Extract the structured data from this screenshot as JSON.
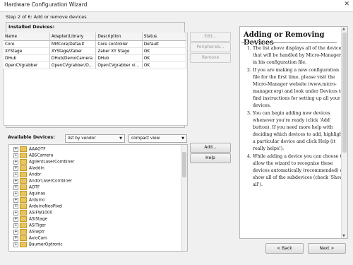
{
  "window": {
    "title": "Hardware Configuration Wizard",
    "close_glyph": "✕"
  },
  "step_label": "Step 2 of 6: Add or remove devices",
  "installed": {
    "label": "Installed Devices:",
    "columns": [
      "Name",
      "Adapter/Library",
      "Description",
      "Status"
    ],
    "rows": [
      [
        "Core",
        "MMCore/Default",
        "Core controller",
        "Default"
      ],
      [
        "XYStage",
        "XYStage/Zaber",
        "Zaber XY Stage",
        "OK"
      ],
      [
        "DHub",
        "DHub/DemoCamera",
        "DHub",
        "OK"
      ],
      [
        "OpenCVgrabber",
        "OpenCVgrabber/O...",
        "OpenCVgrabber vi...",
        "OK"
      ]
    ],
    "buttons": {
      "edit": "Edit...",
      "peripherals": "Peripherals...",
      "remove": "Remove"
    }
  },
  "available": {
    "label": "Available Devices:",
    "sort_combo": "list by vendor",
    "view_combo": "compact view",
    "buttons": {
      "add": "Add...",
      "help": "Help"
    },
    "items": [
      "AAAOTF",
      "ABSCamera",
      "AgilentLaserCombiner",
      "Aladdin",
      "Andor",
      "AndorLaserCombiner",
      "AOTF",
      "Aquinas",
      "Arduino",
      "ArduinoNeoPixel",
      "ASIFW1000",
      "ASIStage",
      "ASITiger",
      "ASIwptr",
      "AxioCam",
      "BaumerOptronic"
    ]
  },
  "help": {
    "heading": "Adding or Removing Devices",
    "items": [
      "The list above displays all of the devices that will be handled by Micro-Manager in his configuration file.",
      "If you are making a new configuration file for the first time, please visit the Micro-Manager website (www.micro-manager.org) and look under Devices to find instructions for setting up all your devices.",
      "You can begin adding new devices whenever you're ready (click 'Add' button). If you need more help with deciding which devices to add, highlight a particular device and click Help (it really helps!).",
      "While adding a device you can choose to allow the wizard to recognize these devices automatically (recommended) or show all of the subdevices (check 'Show all')."
    ]
  },
  "nav": {
    "back": "< Back",
    "next": "Next >"
  }
}
